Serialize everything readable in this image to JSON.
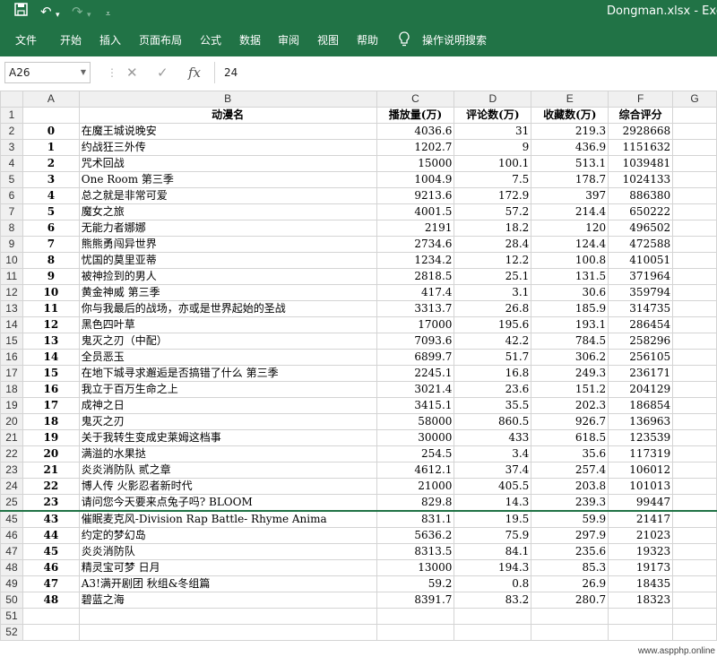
{
  "titlebar": {
    "title": "Dongman.xlsx  -  Excel",
    "save_icon": "save-icon",
    "undo_icon": "undo-icon",
    "redo_icon": "redo-icon",
    "customize_icon": "customize-icon",
    "bg_color": "#217346"
  },
  "ribbon": {
    "tabs": [
      "文件",
      "开始",
      "插入",
      "页面布局",
      "公式",
      "数据",
      "审阅",
      "视图",
      "帮助"
    ],
    "tell_me": "操作说明搜索"
  },
  "formula_bar": {
    "name_box": "A26",
    "value": "24"
  },
  "columns": [
    "",
    "A",
    "B",
    "C",
    "D",
    "E",
    "F",
    "G"
  ],
  "header_row": {
    "num": "1",
    "cells": [
      "",
      "动漫名",
      "播放量(万)",
      "评论数(万)",
      "收藏数(万)",
      "综合评分",
      ""
    ]
  },
  "rows": [
    {
      "num": "2",
      "cells": [
        "0",
        "在魔王城说晚安",
        "4036.6",
        "31",
        "219.3",
        "2928668",
        ""
      ]
    },
    {
      "num": "3",
      "cells": [
        "1",
        "约战狂三外传",
        "1202.7",
        "9",
        "436.9",
        "1151632",
        ""
      ]
    },
    {
      "num": "4",
      "cells": [
        "2",
        "咒术回战",
        "15000",
        "100.1",
        "513.1",
        "1039481",
        ""
      ]
    },
    {
      "num": "5",
      "cells": [
        "3",
        "One Room 第三季",
        "1004.9",
        "7.5",
        "178.7",
        "1024133",
        ""
      ]
    },
    {
      "num": "6",
      "cells": [
        "4",
        "总之就是非常可爱",
        "9213.6",
        "172.9",
        "397",
        "886380",
        ""
      ]
    },
    {
      "num": "7",
      "cells": [
        "5",
        "魔女之旅",
        "4001.5",
        "57.2",
        "214.4",
        "650222",
        ""
      ]
    },
    {
      "num": "8",
      "cells": [
        "6",
        "无能力者娜娜",
        "2191",
        "18.2",
        "120",
        "496502",
        ""
      ]
    },
    {
      "num": "9",
      "cells": [
        "7",
        "熊熊勇闯异世界",
        "2734.6",
        "28.4",
        "124.4",
        "472588",
        ""
      ]
    },
    {
      "num": "10",
      "cells": [
        "8",
        "忧国的莫里亚蒂",
        "1234.2",
        "12.2",
        "100.8",
        "410051",
        ""
      ]
    },
    {
      "num": "11",
      "cells": [
        "9",
        "被神捡到的男人",
        "2818.5",
        "25.1",
        "131.5",
        "371964",
        ""
      ]
    },
    {
      "num": "12",
      "cells": [
        "10",
        "黄金神威 第三季",
        "417.4",
        "3.1",
        "30.6",
        "359794",
        ""
      ]
    },
    {
      "num": "13",
      "cells": [
        "11",
        "你与我最后的战场，亦或是世界起始的圣战",
        "3313.7",
        "26.8",
        "185.9",
        "314735",
        ""
      ]
    },
    {
      "num": "14",
      "cells": [
        "12",
        "黑色四叶草",
        "17000",
        "195.6",
        "193.1",
        "286454",
        ""
      ]
    },
    {
      "num": "15",
      "cells": [
        "13",
        "鬼灭之刃（中配）",
        "7093.6",
        "42.2",
        "784.5",
        "258296",
        ""
      ]
    },
    {
      "num": "16",
      "cells": [
        "14",
        "全员恶玉",
        "6899.7",
        "51.7",
        "306.2",
        "256105",
        ""
      ]
    },
    {
      "num": "17",
      "cells": [
        "15",
        "在地下城寻求邂逅是否搞错了什么 第三季",
        "2245.1",
        "16.8",
        "249.3",
        "236171",
        ""
      ]
    },
    {
      "num": "18",
      "cells": [
        "16",
        "我立于百万生命之上",
        "3021.4",
        "23.6",
        "151.2",
        "204129",
        ""
      ]
    },
    {
      "num": "19",
      "cells": [
        "17",
        "成神之日",
        "3415.1",
        "35.5",
        "202.3",
        "186854",
        ""
      ]
    },
    {
      "num": "20",
      "cells": [
        "18",
        "鬼灭之刃",
        "58000",
        "860.5",
        "926.7",
        "136963",
        ""
      ]
    },
    {
      "num": "21",
      "cells": [
        "19",
        "关于我转生变成史莱姆这档事",
        "30000",
        "433",
        "618.5",
        "123539",
        ""
      ]
    },
    {
      "num": "22",
      "cells": [
        "20",
        "满溢的水果挞",
        "254.5",
        "3.4",
        "35.6",
        "117319",
        ""
      ]
    },
    {
      "num": "23",
      "cells": [
        "21",
        "炎炎消防队 贰之章",
        "4612.1",
        "37.4",
        "257.4",
        "106012",
        ""
      ]
    },
    {
      "num": "24",
      "cells": [
        "22",
        "博人传 火影忍者新时代",
        "21000",
        "405.5",
        "203.8",
        "101013",
        ""
      ]
    },
    {
      "num": "25",
      "cells": [
        "23",
        "请问您今天要来点兔子吗? BLOOM",
        "829.8",
        "14.3",
        "239.3",
        "99447",
        ""
      ]
    },
    {
      "num": "45",
      "cells": [
        "43",
        "催眠麦克风-Division Rap Battle- Rhyme Anima",
        "831.1",
        "19.5",
        "59.9",
        "21417",
        ""
      ]
    },
    {
      "num": "46",
      "cells": [
        "44",
        "约定的梦幻岛",
        "5636.2",
        "75.9",
        "297.9",
        "21023",
        ""
      ]
    },
    {
      "num": "47",
      "cells": [
        "45",
        "炎炎消防队",
        "8313.5",
        "84.1",
        "235.6",
        "19323",
        ""
      ]
    },
    {
      "num": "48",
      "cells": [
        "46",
        "精灵宝可梦 日月",
        "13000",
        "194.3",
        "85.3",
        "19173",
        ""
      ]
    },
    {
      "num": "49",
      "cells": [
        "47",
        "A3!满开剧团 秋组&冬组篇",
        "59.2",
        "0.8",
        "26.9",
        "18435",
        ""
      ]
    },
    {
      "num": "50",
      "cells": [
        "48",
        "碧蓝之海",
        "8391.7",
        "83.2",
        "280.7",
        "18323",
        ""
      ]
    },
    {
      "num": "51",
      "cells": [
        "",
        "",
        "",
        "",
        "",
        "",
        ""
      ]
    },
    {
      "num": "52",
      "cells": [
        "",
        "",
        "",
        "",
        "",
        "",
        ""
      ]
    }
  ],
  "watermark": "www.aspphp.online"
}
